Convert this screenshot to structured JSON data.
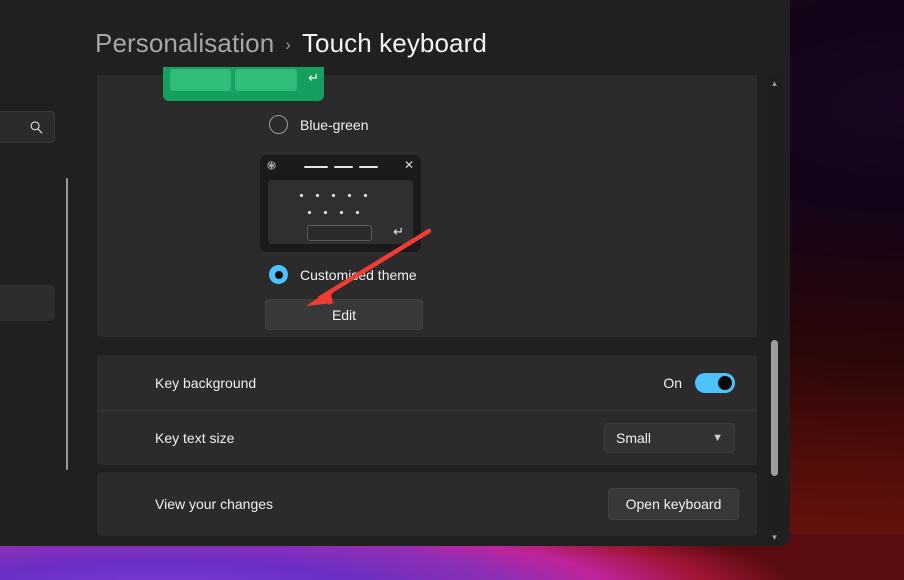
{
  "window": {
    "breadcrumb": {
      "parent": "Personalisation",
      "separator": "›",
      "current": "Touch keyboard"
    }
  },
  "sidebar": {
    "search_placeholder": "",
    "search_icon": "search-icon"
  },
  "theme_section": {
    "options": [
      {
        "id": "blue-green",
        "label": "Blue-green",
        "selected": false,
        "preview_color": "#15a05f"
      },
      {
        "id": "customised-theme",
        "label": "Customised theme",
        "selected": true,
        "preview_color": "#1b1b1b"
      }
    ],
    "edit_button_label": "Edit",
    "keyboard_preview": {
      "gear_icon": "gear-icon",
      "close_icon": "close-icon",
      "enter_icon": "↵"
    }
  },
  "settings_rows": [
    {
      "label": "Key background",
      "control": "toggle",
      "state_text": "On",
      "enabled": true,
      "accent": "#4cc2ff"
    },
    {
      "label": "Key text size",
      "control": "select",
      "value": "Small",
      "chevron": "⌄"
    }
  ],
  "view_changes": {
    "label": "View your changes",
    "button_label": "Open keyboard"
  },
  "scrollbar": {
    "up_arrow": "▲",
    "down_arrow": "▼"
  },
  "annotation": {
    "type": "arrow",
    "color": "#f03c34",
    "points_to": "Edit"
  }
}
